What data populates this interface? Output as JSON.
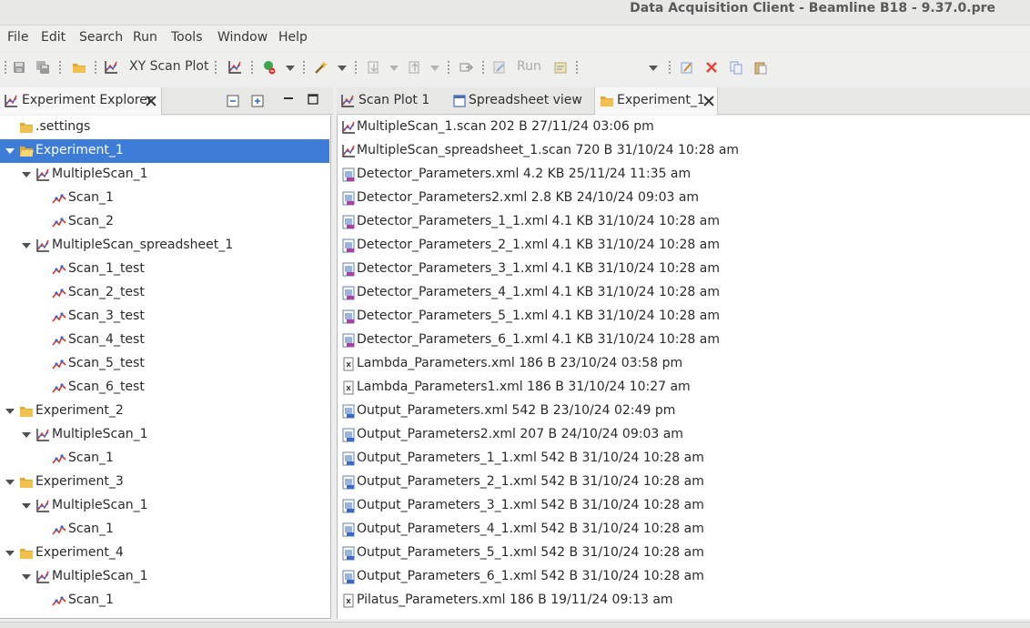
{
  "window": {
    "title": "Data Acquisition Client - Beamline B18 - 9.37.0.pre"
  },
  "menubar": {
    "items": [
      "File",
      "Edit",
      "Search",
      "Run",
      "Tools",
      "Window",
      "Help"
    ]
  },
  "toolbar": {
    "xy_scan_plot_label": "XY Scan Plot",
    "run_label": "Run"
  },
  "left_view": {
    "tab_label": "Experiment Explorer",
    "tree": [
      {
        "label": ".settings",
        "icon": "folder-icon"
      },
      {
        "label": "Experiment_1",
        "icon": "folder-open-icon",
        "selected": true
      },
      {
        "label": "MultipleScan_1",
        "icon": "multiscan-icon"
      },
      {
        "label": "Scan_1",
        "icon": "scan-icon"
      },
      {
        "label": "Scan_2",
        "icon": "scan-icon"
      },
      {
        "label": "MultipleScan_spreadsheet_1",
        "icon": "multiscan-icon"
      },
      {
        "label": "Scan_1_test",
        "icon": "scan-icon"
      },
      {
        "label": "Scan_2_test",
        "icon": "scan-icon"
      },
      {
        "label": "Scan_3_test",
        "icon": "scan-icon"
      },
      {
        "label": "Scan_4_test",
        "icon": "scan-icon"
      },
      {
        "label": "Scan_5_test",
        "icon": "scan-icon"
      },
      {
        "label": "Scan_6_test",
        "icon": "scan-icon"
      },
      {
        "label": "Experiment_2",
        "icon": "folder-icon"
      },
      {
        "label": "MultipleScan_1",
        "icon": "multiscan-icon"
      },
      {
        "label": "Scan_1",
        "icon": "scan-icon"
      },
      {
        "label": "Experiment_3",
        "icon": "folder-icon"
      },
      {
        "label": "MultipleScan_1",
        "icon": "multiscan-icon"
      },
      {
        "label": "Scan_1",
        "icon": "scan-icon"
      },
      {
        "label": "Experiment_4",
        "icon": "folder-icon"
      },
      {
        "label": "MultipleScan_1",
        "icon": "multiscan-icon"
      },
      {
        "label": "Scan_1",
        "icon": "scan-icon"
      }
    ]
  },
  "right_view": {
    "tabs": [
      {
        "label": "Scan Plot 1",
        "icon": "plot-icon"
      },
      {
        "label": "Spreadsheet view",
        "icon": "spreadsheet-icon"
      },
      {
        "label": "Experiment_1",
        "icon": "folder-icon",
        "active": true
      }
    ],
    "files": [
      {
        "text": "MultipleScan_1.scan  202 B  27/11/24 03:06 pm",
        "icon": "multiscan-icon"
      },
      {
        "text": "MultipleScan_spreadsheet_1.scan  720 B  31/10/24 10:28 am",
        "icon": "multiscan-icon"
      },
      {
        "text": "Detector_Parameters.xml  4.2 KB  25/11/24 11:35 am",
        "icon": "detector-file-icon"
      },
      {
        "text": "Detector_Parameters2.xml  2.8 KB  24/10/24 09:03 am",
        "icon": "detector-file-icon"
      },
      {
        "text": "Detector_Parameters_1_1.xml  4.1 KB  31/10/24 10:28 am",
        "icon": "detector-file-icon"
      },
      {
        "text": "Detector_Parameters_2_1.xml  4.1 KB  31/10/24 10:28 am",
        "icon": "detector-file-icon"
      },
      {
        "text": "Detector_Parameters_3_1.xml  4.1 KB  31/10/24 10:28 am",
        "icon": "detector-file-icon"
      },
      {
        "text": "Detector_Parameters_4_1.xml  4.1 KB  31/10/24 10:28 am",
        "icon": "detector-file-icon"
      },
      {
        "text": "Detector_Parameters_5_1.xml  4.1 KB  31/10/24 10:28 am",
        "icon": "detector-file-icon"
      },
      {
        "text": "Detector_Parameters_6_1.xml  4.1 KB  31/10/24 10:28 am",
        "icon": "detector-file-icon"
      },
      {
        "text": "Lambda_Parameters.xml  186 B  23/10/24 03:58 pm",
        "icon": "xml-file-icon"
      },
      {
        "text": "Lambda_Parameters1.xml  186 B  31/10/24 10:27 am",
        "icon": "xml-file-icon"
      },
      {
        "text": "Output_Parameters.xml  542 B  23/10/24 02:49 pm",
        "icon": "output-file-icon"
      },
      {
        "text": "Output_Parameters2.xml  207 B  24/10/24 09:03 am",
        "icon": "output-file-icon"
      },
      {
        "text": "Output_Parameters_1_1.xml  542 B  31/10/24 10:28 am",
        "icon": "output-file-icon"
      },
      {
        "text": "Output_Parameters_2_1.xml  542 B  31/10/24 10:28 am",
        "icon": "output-file-icon"
      },
      {
        "text": "Output_Parameters_3_1.xml  542 B  31/10/24 10:28 am",
        "icon": "output-file-icon"
      },
      {
        "text": "Output_Parameters_4_1.xml  542 B  31/10/24 10:28 am",
        "icon": "output-file-icon"
      },
      {
        "text": "Output_Parameters_5_1.xml  542 B  31/10/24 10:28 am",
        "icon": "output-file-icon"
      },
      {
        "text": "Output_Parameters_6_1.xml  542 B  31/10/24 10:28 am",
        "icon": "output-file-icon"
      },
      {
        "text": "Pilatus_Parameters.xml  186 B  19/11/24 09:13 am",
        "icon": "xml-file-icon"
      }
    ]
  },
  "colors": {
    "selection": "#3d7dd8",
    "folder": "#f2c04d",
    "scan_red": "#d9342b",
    "file_blue": "#3b69c9"
  }
}
